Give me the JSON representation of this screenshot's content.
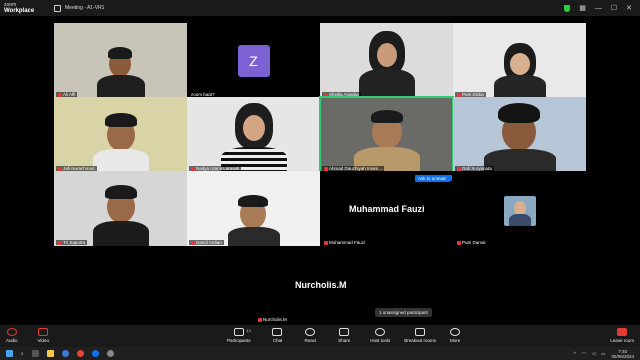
{
  "app": {
    "logo_line1": "zoom",
    "logo_line2": "Workplace",
    "window_title": "Meeting - A1-VR1"
  },
  "participants": [
    {
      "name": "Ali Affi"
    },
    {
      "name": "zoom baat?",
      "initial": "Z"
    },
    {
      "name": "Sheilla Anggita"
    },
    {
      "name": "Putri Dicka"
    },
    {
      "name": "Jafi Nurachman"
    },
    {
      "name": "Nadya Utami Larasati"
    },
    {
      "name": "Ahmad Dauzhiyah Imam..."
    },
    {
      "name": "Dafi Suryanata"
    },
    {
      "name": "Tri Saputra"
    },
    {
      "name": "Dandi Ardian"
    },
    {
      "name": "Muhammad Fauzi",
      "big_name": "Muhammad Fauzi"
    },
    {
      "name": "Putri Damai"
    }
  ],
  "unmute": {
    "label": "Ask to unmute"
  },
  "bottom_speaker": {
    "big_name": "Nurcholis.M",
    "name": "Nurcholis.M"
  },
  "tooltip": "1 unassigned participant",
  "toolbar": {
    "audio": "Audio",
    "video": "Video",
    "participants": "Participants",
    "participants_count": "13",
    "chat": "Chat",
    "react": "React",
    "share": "Share",
    "host_tools": "Host tools",
    "breakout": "Breakout rooms",
    "more": "More",
    "leave": "Leave room"
  },
  "taskbar": {
    "time": "7:40",
    "date": "06/06/2024"
  },
  "colors": {
    "speaker_outline": "#2ecc71",
    "avatar_purple": "#7b61d4",
    "accent_blue": "#0e72ed"
  }
}
